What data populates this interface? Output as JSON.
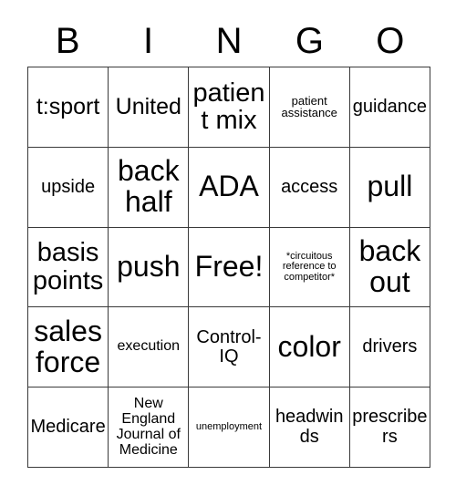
{
  "card": {
    "title": "BINGO",
    "background_color": "#ffffff",
    "text_color": "#000000",
    "border_color": "#3a3a3a",
    "header": {
      "letters": [
        "B",
        "I",
        "N",
        "G",
        "O"
      ]
    },
    "columns": 5,
    "rows": 5,
    "free_space_label": "Free!",
    "cells": [
      [
        {
          "text": "t:sport",
          "size": "lg"
        },
        {
          "text": "United",
          "size": "lg"
        },
        {
          "text": "patient mix",
          "size": "xl"
        },
        {
          "text": "patient assistance",
          "size": "xs"
        },
        {
          "text": "guidance",
          "size": "md"
        }
      ],
      [
        {
          "text": "upside",
          "size": "md"
        },
        {
          "text": "back half",
          "size": "xxl"
        },
        {
          "text": "ADA",
          "size": "xxl"
        },
        {
          "text": "access",
          "size": "md"
        },
        {
          "text": "pull",
          "size": "xxl"
        }
      ],
      [
        {
          "text": "basis points",
          "size": "xl"
        },
        {
          "text": "push",
          "size": "xxl"
        },
        {
          "text": "Free!",
          "size": "xxl"
        },
        {
          "text": "*circuitous reference to competitor*",
          "size": "xxs"
        },
        {
          "text": "back out",
          "size": "xxl"
        }
      ],
      [
        {
          "text": "sales force",
          "size": "xxl"
        },
        {
          "text": "execution",
          "size": "sm"
        },
        {
          "text": "Control-IQ",
          "size": "md"
        },
        {
          "text": "color",
          "size": "xxl"
        },
        {
          "text": "drivers",
          "size": "md"
        }
      ],
      [
        {
          "text": "Medicare",
          "size": "md"
        },
        {
          "text": "New England Journal of Medicine",
          "size": "sm"
        },
        {
          "text": "unemployment",
          "size": "xxs"
        },
        {
          "text": "headwinds",
          "size": "md"
        },
        {
          "text": "prescribers",
          "size": "md"
        }
      ]
    ]
  }
}
